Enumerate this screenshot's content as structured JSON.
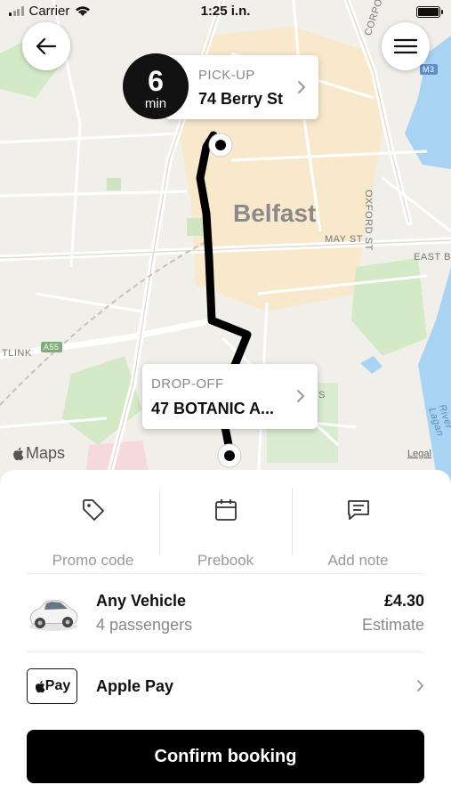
{
  "status_bar": {
    "carrier": "Carrier",
    "time": "1:25 i.n."
  },
  "map": {
    "city_label": "Belfast",
    "street_labels": [
      "MAY ST",
      "EAST B",
      "OXFORD ST",
      "CORPO",
      "TLINK",
      "River Lagan",
      "S",
      "M3",
      "A55"
    ],
    "pickup": {
      "eta_value": "6",
      "eta_unit": "min",
      "label": "PICK-UP",
      "address": "74 Berry St"
    },
    "dropoff": {
      "label": "DROP-OFF",
      "address": "47 BOTANIC A..."
    },
    "attribution": "Maps",
    "legal": "Legal",
    "route_color": "#000000"
  },
  "options": [
    {
      "label": "Promo code",
      "icon": "tag-icon"
    },
    {
      "label": "Prebook",
      "icon": "calendar-icon"
    },
    {
      "label": "Add note",
      "icon": "note-icon"
    }
  ],
  "vehicle": {
    "name": "Any Vehicle",
    "passengers": "4 passengers",
    "price": "£4.30",
    "price_note": "Estimate"
  },
  "payment": {
    "badge": "Pay",
    "name": "Apple Pay"
  },
  "confirm_label": "Confirm booking",
  "colors": {
    "primary": "#000000",
    "muted_text": "#888888",
    "map_background": "#f1efea",
    "water": "#a9d3f2",
    "park": "#cfe8c2",
    "urban": "#fbe7c2"
  }
}
